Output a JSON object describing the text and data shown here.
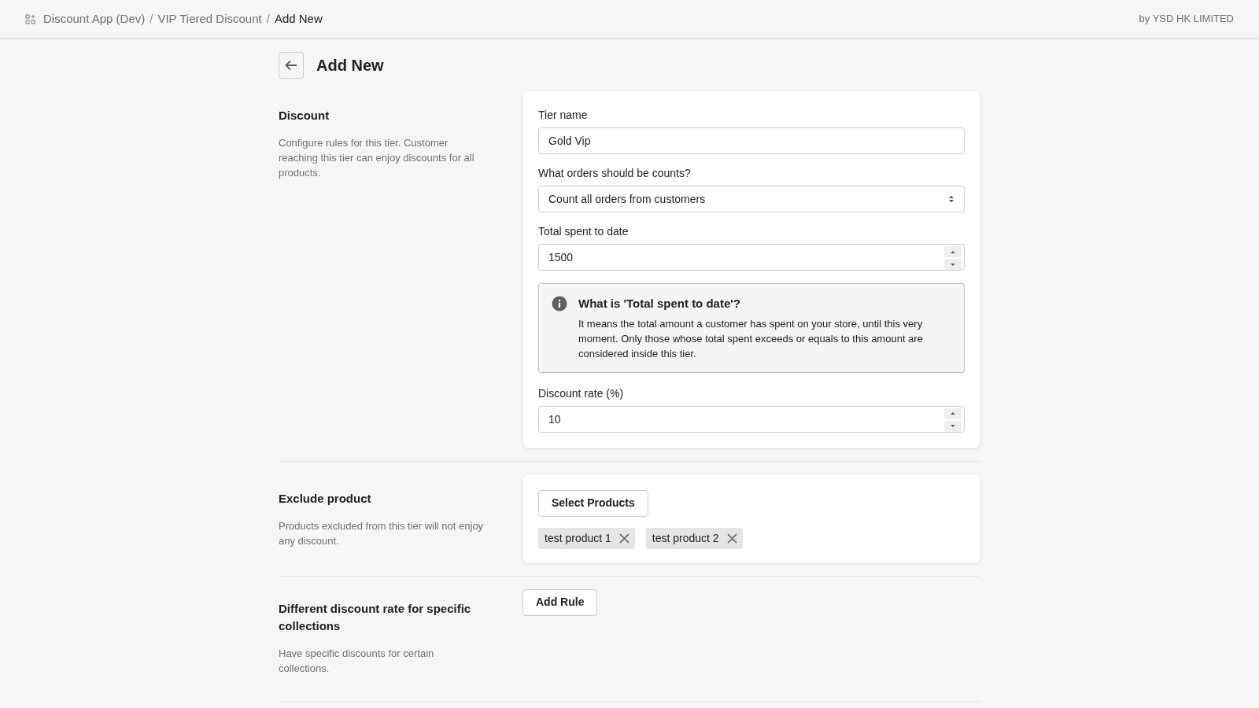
{
  "header": {
    "breadcrumbs": [
      {
        "label": "Discount App (Dev)",
        "current": false
      },
      {
        "label": "VIP Tiered Discount",
        "current": false
      },
      {
        "label": "Add New",
        "current": true
      }
    ],
    "separator": "/",
    "vendor": "by YSD HK LIMITED"
  },
  "page": {
    "title": "Add New"
  },
  "sections": [
    {
      "kind": "form",
      "title": "Discount",
      "description": "Configure rules for this tier. Customer reaching this tier can enjoy discounts for all products.",
      "fields": [
        {
          "kind": "text",
          "label": "Tier name",
          "value": "Gold Vip"
        },
        {
          "kind": "select",
          "label": "What orders should be counts?",
          "value": "Count all orders from customers"
        },
        {
          "kind": "number",
          "label": "Total spent to date",
          "value": "1500"
        },
        {
          "kind": "info",
          "title": "What is 'Total spent to date'?",
          "text": "It means the total amount a customer has spent on your store, until this very moment. Only those whose total spent exceeds or equals to this amount are considered inside this tier."
        },
        {
          "kind": "number",
          "label": "Discount rate (%)",
          "value": "10"
        }
      ]
    },
    {
      "kind": "products",
      "title": "Exclude product",
      "description": "Products excluded from this tier will not enjoy any discount.",
      "button": "Select Products",
      "tags": [
        "test product 1",
        "test product 2"
      ]
    },
    {
      "kind": "rules",
      "title": "Different discount rate for specific collections",
      "description": "Have specific discounts for certain collections.",
      "button": "Add Rule"
    }
  ]
}
